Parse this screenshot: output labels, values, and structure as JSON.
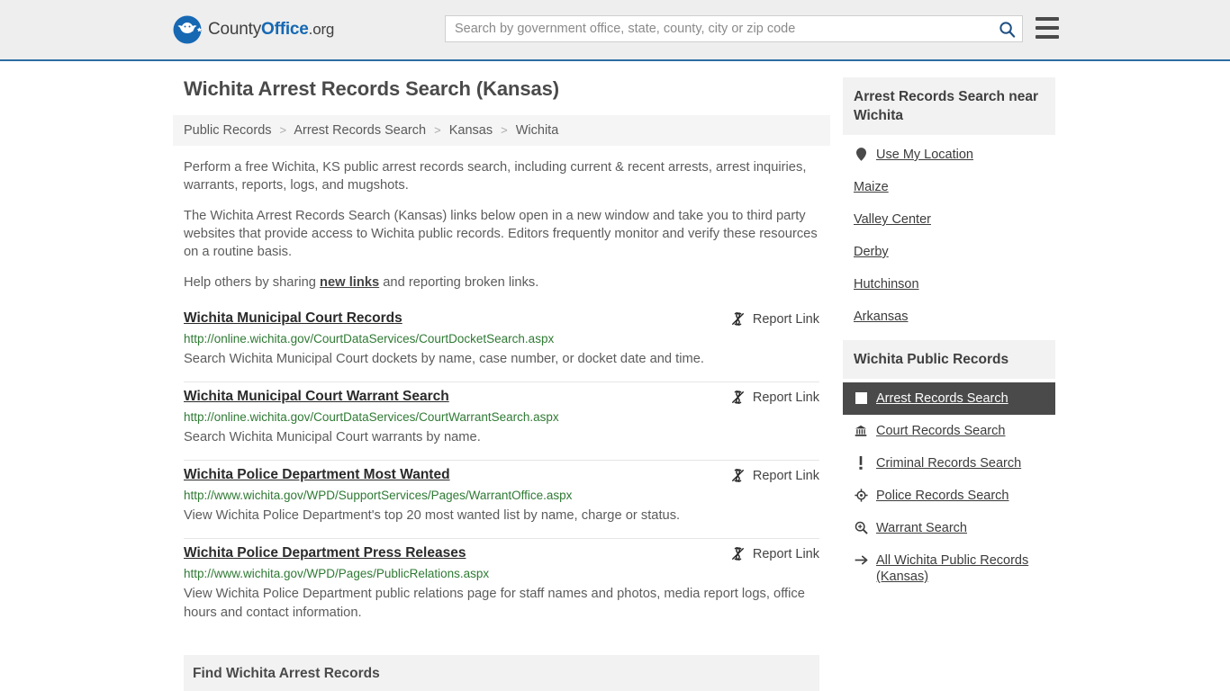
{
  "header": {
    "brand": {
      "part1": "County",
      "part2": "Office",
      "part3": ".org",
      "logo_icon": "eagle-seal-logo"
    },
    "search": {
      "placeholder": "Search by government office, state, county, city or zip code",
      "value": "",
      "icon": "search-icon"
    },
    "menu_icon": "hamburger-menu-icon"
  },
  "page": {
    "title": "Wichita Arrest Records Search (Kansas)",
    "breadcrumb": [
      {
        "label": "Public Records"
      },
      {
        "label": "Arrest Records Search"
      },
      {
        "label": "Kansas"
      },
      {
        "label": "Wichita"
      }
    ],
    "breadcrumb_separator": ">",
    "intro": [
      "Perform a free Wichita, KS public arrest records search, including current & recent arrests, arrest inquiries, warrants, reports, logs, and mugshots.",
      "The Wichita Arrest Records Search (Kansas) links below open in a new window and take you to third party websites that provide access to Wichita public records. Editors frequently monitor and verify these resources on a routine basis."
    ],
    "help_prefix": "Help others by sharing ",
    "help_link": "new links",
    "help_suffix": " and reporting broken links.",
    "report_link_label": "Report Link",
    "report_link_icon": "broken-link-icon",
    "section_band_title": "Find Wichita Arrest Records"
  },
  "results": [
    {
      "title": "Wichita Municipal Court Records",
      "url": "http://online.wichita.gov/CourtDataServices/CourtDocketSearch.aspx",
      "description": "Search Wichita Municipal Court dockets by name, case number, or docket date and time."
    },
    {
      "title": "Wichita Municipal Court Warrant Search",
      "url": "http://online.wichita.gov/CourtDataServices/CourtWarrantSearch.aspx",
      "description": "Search Wichita Municipal Court warrants by name."
    },
    {
      "title": "Wichita Police Department Most Wanted",
      "url": "http://www.wichita.gov/WPD/SupportServices/Pages/WarrantOffice.aspx",
      "description": "View Wichita Police Department's top 20 most wanted list by name, charge or status."
    },
    {
      "title": "Wichita Police Department Press Releases",
      "url": "http://www.wichita.gov/WPD/Pages/PublicRelations.aspx",
      "description": "View Wichita Police Department public relations page for staff names and photos, media report logs, office hours and contact information."
    }
  ],
  "sidebar": {
    "nearby": {
      "heading": "Arrest Records Search near Wichita",
      "items": [
        {
          "label": "Use My Location",
          "icon": "map-pin-icon"
        },
        {
          "label": "Maize",
          "icon": ""
        },
        {
          "label": "Valley Center",
          "icon": ""
        },
        {
          "label": "Derby",
          "icon": ""
        },
        {
          "label": "Hutchinson",
          "icon": ""
        },
        {
          "label": "Arkansas",
          "icon": ""
        }
      ]
    },
    "public_records": {
      "heading": "Wichita Public Records",
      "items": [
        {
          "label": "Arrest Records Search",
          "icon": "handcuffs-icon",
          "active": true
        },
        {
          "label": "Court Records Search",
          "icon": "courthouse-icon",
          "active": false
        },
        {
          "label": "Criminal Records Search",
          "icon": "exclamation-icon",
          "active": false
        },
        {
          "label": "Police Records Search",
          "icon": "police-badge-icon",
          "active": false
        },
        {
          "label": "Warrant Search",
          "icon": "magnifier-plus-icon",
          "active": false
        },
        {
          "label": "All Wichita Public Records (Kansas)",
          "icon": "arrow-right-icon",
          "active": false
        }
      ]
    }
  },
  "colors": {
    "brand_blue": "#1668b3",
    "header_bg": "#eeeeee",
    "header_border": "#2e6da4",
    "url_green": "#2f7a34",
    "active_bg": "#4a4a4a"
  }
}
